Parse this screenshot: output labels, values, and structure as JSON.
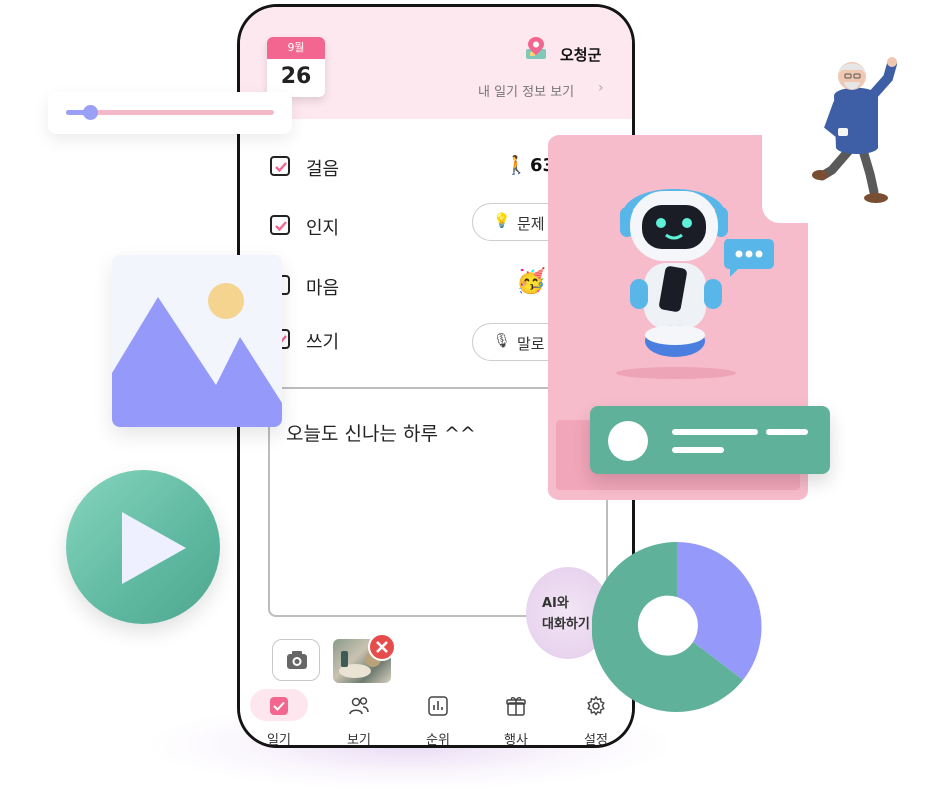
{
  "header": {
    "calendar_month": "9월",
    "calendar_day": "26",
    "region_name": "오청군",
    "diary_info_link": "내 일기 정보 보기",
    "diary_info_chevron": "›"
  },
  "tasks": {
    "walk": {
      "label": "걸음",
      "checked": true,
      "step_count": "63"
    },
    "cognition": {
      "label": "인지",
      "checked": true,
      "action_label": "문제"
    },
    "mind": {
      "label": "마음",
      "checked": false
    },
    "write": {
      "label": "쓰기",
      "checked": true,
      "action_label": "말로"
    }
  },
  "diary": {
    "text": "오늘도 신나는 하루 ^^"
  },
  "ai_chat": {
    "line1": "AI와",
    "line2": "대화하기"
  },
  "bottom_nav": [
    {
      "label": "일기",
      "icon": "check-square-icon",
      "active": true
    },
    {
      "label": "보기",
      "icon": "people-icon",
      "active": false
    },
    {
      "label": "순위",
      "icon": "bar-chart-icon",
      "active": false
    },
    {
      "label": "행사",
      "icon": "gift-icon",
      "active": false
    },
    {
      "label": "설정",
      "icon": "gear-icon",
      "active": false
    }
  ],
  "colors": {
    "accent_pink": "#f2668f",
    "header_bg": "#fde8ef",
    "teal": "#5fb19a",
    "lavender": "#9aa0f5",
    "robot_card_pink": "#f7bccb"
  },
  "slider": {
    "value_fraction": 0.12
  },
  "donut_chart": {
    "segments": [
      {
        "value": 0.38,
        "color": "#9aa0f5"
      },
      {
        "value": 0.62,
        "color": "#5fb19a"
      }
    ]
  }
}
